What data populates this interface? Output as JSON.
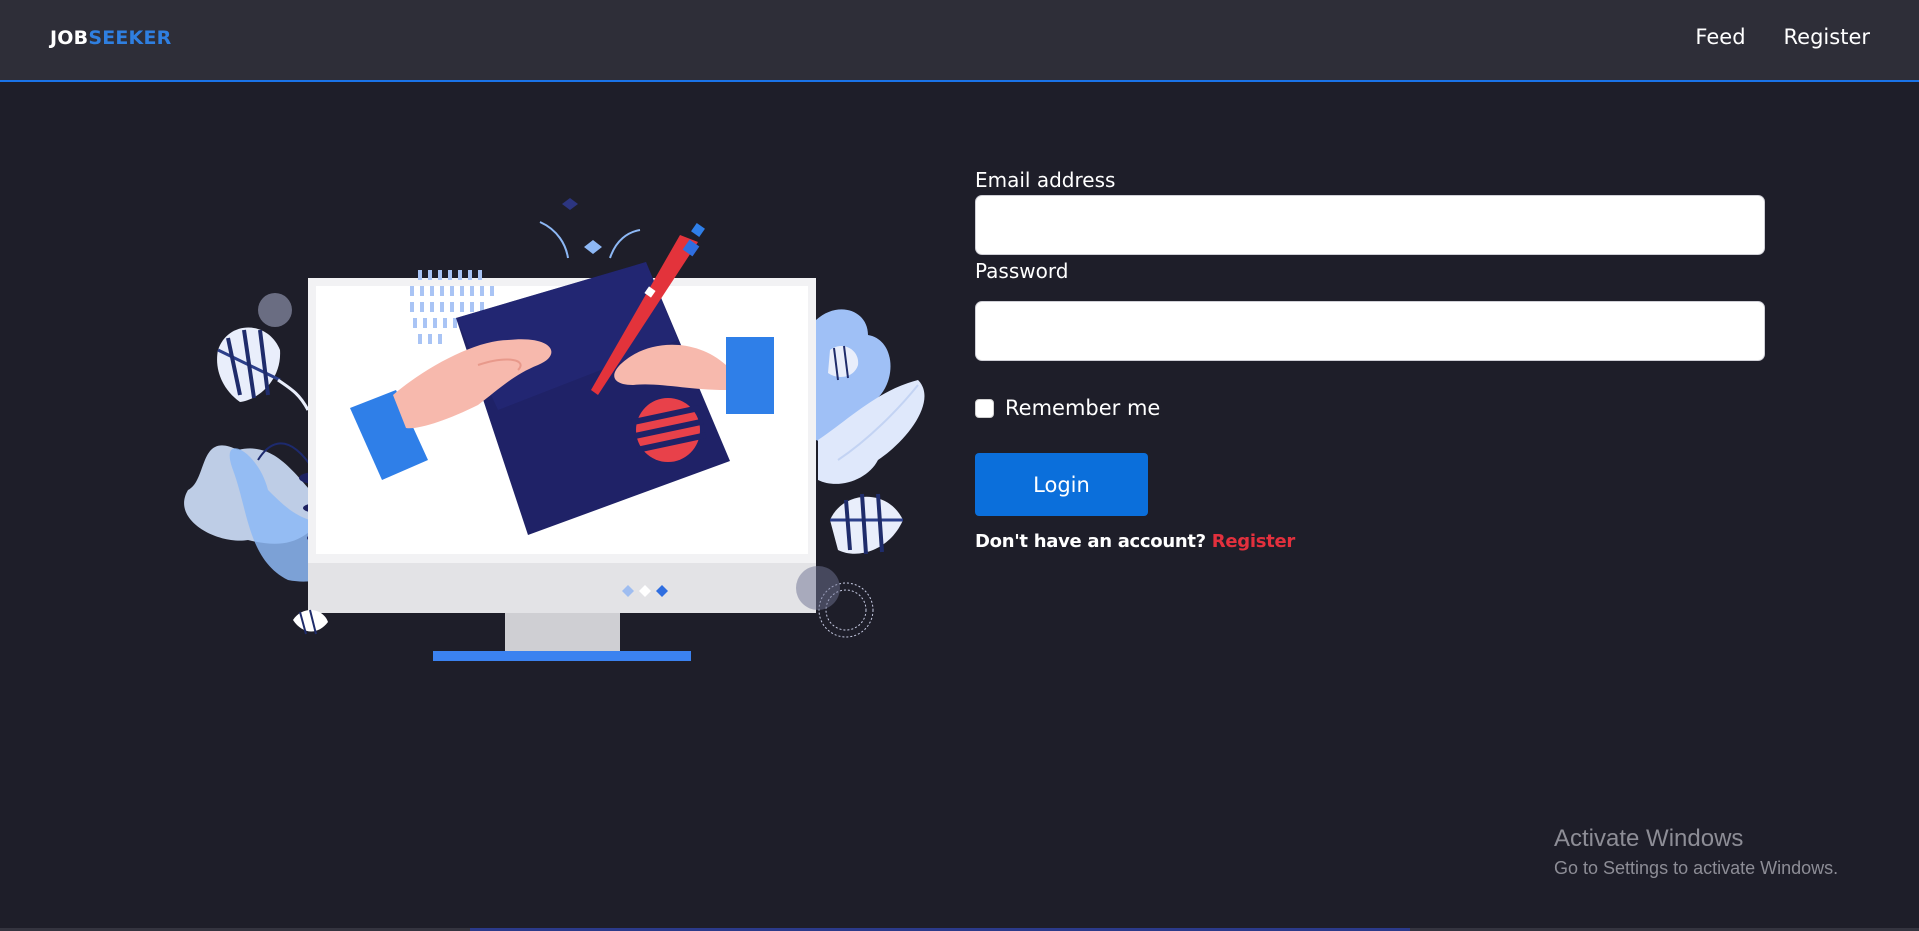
{
  "navbar": {
    "brand_part1": "JOB",
    "brand_part2": "SEEKER",
    "links": [
      {
        "label": "Feed"
      },
      {
        "label": "Register"
      }
    ]
  },
  "login_form": {
    "email_label": "Email address",
    "email_value": "",
    "email_placeholder": "",
    "password_label": "Password",
    "password_value": "",
    "password_placeholder": "",
    "remember_label": "Remember me",
    "remember_checked": false,
    "login_button_label": "Login",
    "no_account_text": "Don't have an account?",
    "register_link_label": "Register"
  },
  "watermark": {
    "title": "Activate Windows",
    "subtitle": "Go to Settings to activate Windows."
  },
  "colors": {
    "background": "#1e1e29",
    "navbar": "#2e2e38",
    "accent_blue": "#0b6fdb",
    "brand_blue": "#2f7fe0",
    "register_red": "#e3303d"
  },
  "icons": {
    "illustration": "desktop-monitor-illustration",
    "checkbox": "checkbox-icon"
  }
}
